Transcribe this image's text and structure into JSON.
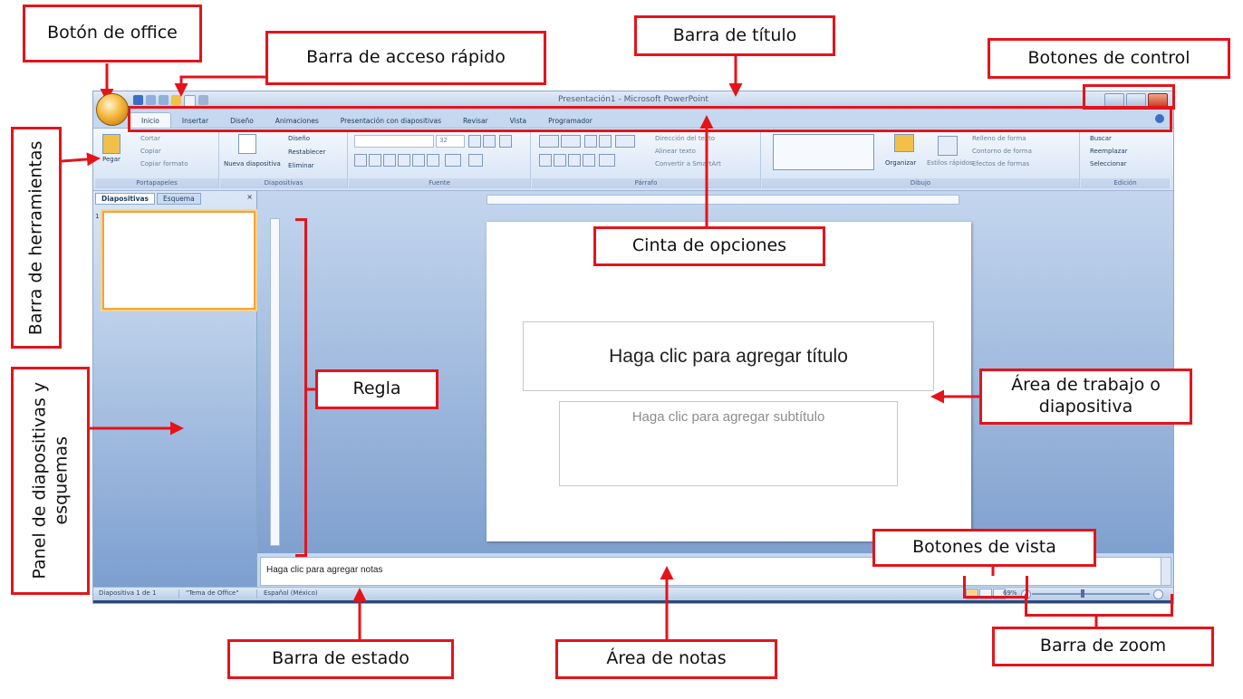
{
  "window": {
    "title": "Presentación1 - Microsoft PowerPoint"
  },
  "ribbon": {
    "tabs": [
      "Inicio",
      "Insertar",
      "Diseño",
      "Animaciones",
      "Presentación con diapositivas",
      "Revisar",
      "Vista",
      "Programador"
    ],
    "portapapeles": {
      "label": "Portapapeles",
      "paste": "Pegar",
      "cut": "Cortar",
      "copy": "Copiar",
      "format_painter": "Copiar formato"
    },
    "diapositivas": {
      "label": "Diapositivas",
      "new_slide": "Nueva diapositiva",
      "design": "Diseño",
      "reset": "Restablecer",
      "delete": "Eliminar"
    },
    "fuente": {
      "label": "Fuente",
      "size": "32"
    },
    "parrafo": {
      "label": "Párrafo",
      "text_direction": "Dirección del texto",
      "align_text": "Alinear texto",
      "smartart": "Convertir a SmartArt"
    },
    "dibujo": {
      "label": "Dibujo",
      "arrange": "Organizar",
      "quick_styles": "Estilos rápidos",
      "shape_fill": "Relleno de forma",
      "shape_outline": "Contorno de forma",
      "shape_effects": "Efectos de formas"
    },
    "edicion": {
      "label": "Edición",
      "find": "Buscar",
      "replace": "Reemplazar",
      "select": "Seleccionar"
    }
  },
  "slide_panel": {
    "tabs": [
      "Diapositivas",
      "Esquema"
    ],
    "close": "×",
    "slide_number": "1"
  },
  "slide": {
    "title_placeholder": "Haga clic para agregar título",
    "subtitle_placeholder": "Haga clic para agregar subtítulo"
  },
  "notes": {
    "placeholder": "Haga clic para agregar notas"
  },
  "status_bar": {
    "slide_info": "Diapositiva 1 de 1",
    "theme": "\"Tema de Office\"",
    "language": "Español (México)",
    "zoom": "69%"
  },
  "callouts": {
    "office_button": "Botón de office",
    "quick_access": "Barra de acceso rápido",
    "title_bar": "Barra de título",
    "control_buttons": "Botones de control",
    "toolbar": "Barra de herramientas",
    "ribbon": "Cinta de opciones",
    "ruler": "Regla",
    "slide_panel": "Panel de diapositivas y esquemas",
    "work_area": "Área de trabajo o diapositiva",
    "view_buttons": "Botones de vista",
    "status_bar": "Barra de estado",
    "notes_area": "Área de notas",
    "zoom_bar": "Barra de zoom"
  },
  "colors": {
    "callout_red": "#e4141b",
    "ribbon_blue": "#d4e2f4",
    "office_orange": "#f5b73b"
  }
}
